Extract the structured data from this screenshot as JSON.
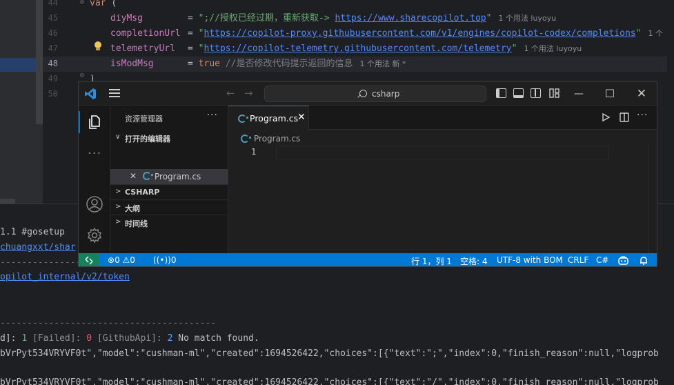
{
  "bg_editor": {
    "lines": [
      {
        "num": "44",
        "kind": "var"
      },
      {
        "num": "45",
        "kind": "diy"
      },
      {
        "num": "46",
        "kind": "completion"
      },
      {
        "num": "47",
        "kind": "telemetry"
      },
      {
        "num": "48",
        "kind": "ismod"
      },
      {
        "num": "49",
        "kind": "close"
      },
      {
        "num": "50",
        "kind": "empty"
      }
    ],
    "var_kw": "var",
    "var_paren": "(",
    "diy_name": "diyMsg",
    "diy_eq": "= ",
    "diy_str_a": "\";//授权已经过期，重新获取-> ",
    "diy_url": "https://www.sharecopilot.top",
    "diy_str_b": "\"",
    "diy_hint": "1 个用法   luyoyu",
    "comp_name": "completionUrl",
    "comp_eq": "= ",
    "comp_q1": "\"",
    "comp_url": "https://copilot-proxy.githubusercontent.com/v1/engines/copilot-codex/completions",
    "comp_q2": "\"",
    "comp_hint": "1 个",
    "tel_name": "telemetryUrl",
    "tel_eq": "= ",
    "tel_q1": "\"",
    "tel_url": "https://copilot-telemetry.githubusercontent.com/telemetry",
    "tel_q2": "\"",
    "tel_hint": "1 个用法   luyoyu",
    "mod_name": "isModMsg",
    "mod_eq": "= ",
    "mod_true": "true",
    "mod_cmt": "//是否修改代码提示返回的信息",
    "mod_hint": "1 个用法   新 *",
    "close_paren": ")"
  },
  "terminal": {
    "l1": "1.1 #gosetup",
    "l2": "chuangxxt/shar",
    "l3": "----------------",
    "l4": "opilot_internal/v2/token",
    "l5": "----------------------------------------",
    "l6_a": "d]: ",
    "l6_b": "1",
    "l6_c": "    [Failed]: ",
    "l6_d": "0",
    "l6_e": "    [GithubApi]: ",
    "l6_f": "2",
    "l6_g": "  No match found.",
    "l7": "bVrPyt534VRYVF0t\",\"model\":\"cushman-ml\",\"created\":1694526422,\"choices\":[{\"text\":\";\",\"index\":0,\"finish_reason\":null,\"logprob",
    "l8": "bVrPyt534VRYVF0t\",\"model\":\"cushman-ml\",\"created\":1694526422,\"choices\":[{\"text\":\"/\",\"index\":0,\"finish_reason\":null,\"logprob"
  },
  "vscode": {
    "command_center": "csharp",
    "sidebar": {
      "title": "资源管理器",
      "more": "···",
      "open_editors": "打开的编辑器",
      "open_file": "Program.cs",
      "sections": [
        "CSHARP",
        "大纲",
        "时间线"
      ]
    },
    "tab": {
      "name": "Program.cs",
      "close": "✕"
    },
    "breadcrumb": "Program.cs",
    "line_number": "1",
    "status": {
      "errors": "0",
      "warnings": "0",
      "ports": "0",
      "position": "行 1，列 1",
      "spaces": "空格: 4",
      "encoding": "UTF-8 with BOM",
      "eol": "CRLF",
      "language": "C#"
    },
    "colors": {
      "accent": "#0078d4",
      "remote": "#16825d"
    }
  }
}
